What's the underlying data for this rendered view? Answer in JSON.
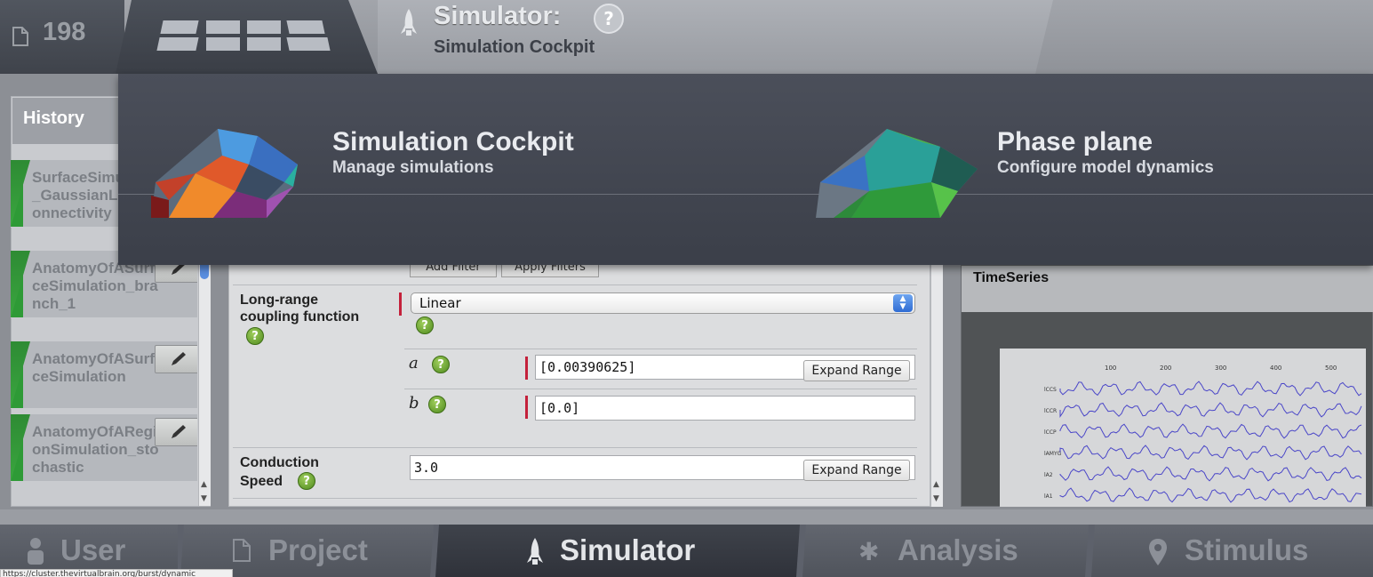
{
  "header": {
    "project_count": "198",
    "simulator_title": "Simulator:",
    "simulator_subtitle": "Simulation Cockpit",
    "help_symbol": "?"
  },
  "overlay": {
    "items": [
      {
        "title": "Simulation Cockpit",
        "subtitle": "Manage simulations"
      },
      {
        "title": "Phase plane",
        "subtitle": "Configure model dynamics"
      }
    ]
  },
  "history": {
    "title": "History",
    "items": [
      {
        "name": "SurfaceSimulation_GaussianLocalConnectivity"
      },
      {
        "name": "AnatomyOfASurfaceSimulation_branch_1"
      },
      {
        "name": "AnatomyOfASurfaceSimulation"
      },
      {
        "name": "AnatomyOfARegionSimulation_stochastic"
      }
    ]
  },
  "form": {
    "add_filter_label": "Add Filter",
    "apply_filters_label": "Apply Filters",
    "coupling_label_line1": "Long-range",
    "coupling_label_line2": "coupling function",
    "coupling_value": "Linear",
    "param_a_name": "a",
    "param_a_value": "[0.00390625]",
    "param_b_name": "b",
    "param_b_value": "[0.0]",
    "expand_range_label": "Expand Range",
    "conduction_label_line1": "Conduction",
    "conduction_label_line2": "Speed",
    "conduction_value": "3.0",
    "help_symbol": "?"
  },
  "timeseries": {
    "title": "TimeSeries",
    "channels": [
      "lCCS",
      "lCCR",
      "lCCP",
      "lAMYG",
      "lA2",
      "lA1"
    ],
    "x_ticks": [
      "100",
      "200",
      "300",
      "400",
      "500"
    ]
  },
  "nav": {
    "user": "User",
    "project": "Project",
    "simulator": "Simulator",
    "analysis": "Analysis",
    "stimulus": "Stimulus"
  },
  "status_bar": {
    "url": "https://cluster.thevirtualbrain.org/burst/dynamic"
  }
}
